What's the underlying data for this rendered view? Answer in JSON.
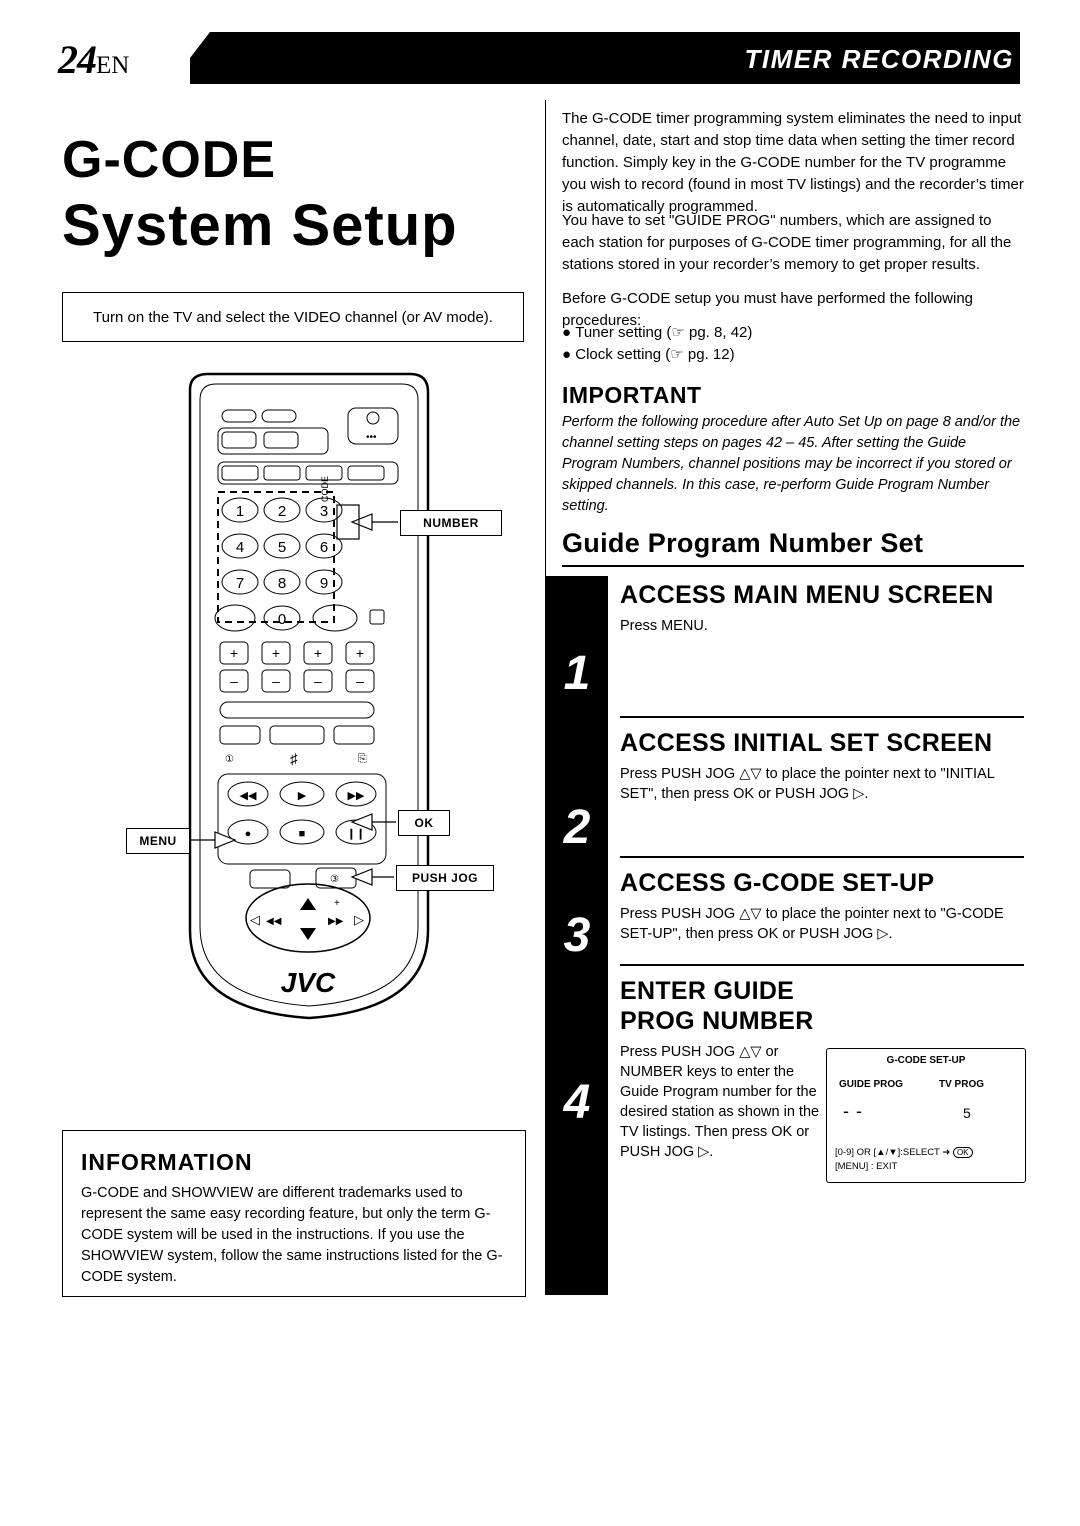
{
  "header": {
    "page_number": "24",
    "page_lang": "EN",
    "section_title": "TIMER RECORDING"
  },
  "title": {
    "line1": "G-CODE",
    "line2": "System Setup"
  },
  "tv_note": "Turn on the TV and select the VIDEO channel (or AV mode).",
  "intro": {
    "p1": "The G-CODE timer programming system eliminates the need to input channel, date, start and stop time data when setting the timer record function. Simply key in the G-CODE number for the TV programme you wish to record (found in most TV listings) and the recorder’s timer is automatically programmed.",
    "p2": "You have to set \"GUIDE PROG\" numbers, which are assigned to each station for purposes of G-CODE timer programming, for all the stations stored in your recorder’s memory to get proper results.",
    "p3": "Before G-CODE setup you must have performed the following procedures:",
    "bullet1": "Tuner setting (☞ pg. 8, 42)",
    "bullet2": "Clock setting (☞ pg. 12)"
  },
  "important": {
    "heading": "IMPORTANT",
    "body": "Perform the following procedure after Auto Set Up on page 8 and/or the channel setting steps on pages 42 – 45. After setting the Guide Program Numbers, channel positions may be incorrect if you stored or skipped channels. In this case, re-perform Guide Program Number setting."
  },
  "guide_section_title": "Guide Program Number Set",
  "steps": [
    {
      "number": "1",
      "title": "ACCESS MAIN MENU SCREEN",
      "body": "Press MENU."
    },
    {
      "number": "2",
      "title": "ACCESS INITIAL SET SCREEN",
      "body": "Press PUSH JOG △▽ to place the pointer next to \"INITIAL SET\", then press OK or PUSH JOG ▷."
    },
    {
      "number": "3",
      "title": "ACCESS G-CODE SET-UP",
      "body": "Press PUSH JOG △▽ to place the pointer next to \"G-CODE SET-UP\", then press OK or PUSH JOG ▷."
    },
    {
      "number": "4",
      "title": "ENTER GUIDE PROG NUMBER",
      "body": "Press PUSH JOG △▽ or NUMBER keys to enter the Guide Program number for the desired station as shown in the TV listings. Then press OK or PUSH JOG ▷."
    }
  ],
  "osd": {
    "title": "G-CODE SET-UP",
    "col1": "GUIDE PROG",
    "col2": "TV PROG",
    "value1": "- -",
    "value2": "5",
    "footer1": "[0-9] OR [▲/▼]:SELECT ➜",
    "footer1_ok": "OK",
    "footer2": "[MENU] : EXIT"
  },
  "information": {
    "heading": "INFORMATION",
    "body": "G-CODE and SHOWVIEW are different trademarks used to represent the same easy recording feature, but only the term G-CODE system will be used in the instructions. If you use the SHOWVIEW system, follow the same instructions listed for the G-CODE system."
  },
  "remote": {
    "brand": "JVC",
    "callouts": {
      "number": "NUMBER",
      "ok": "OK",
      "push_jog": "PUSH JOG",
      "menu": "MENU"
    },
    "keys": [
      "1",
      "2",
      "3",
      "4",
      "5",
      "6",
      "7",
      "8",
      "9",
      "0"
    ]
  }
}
